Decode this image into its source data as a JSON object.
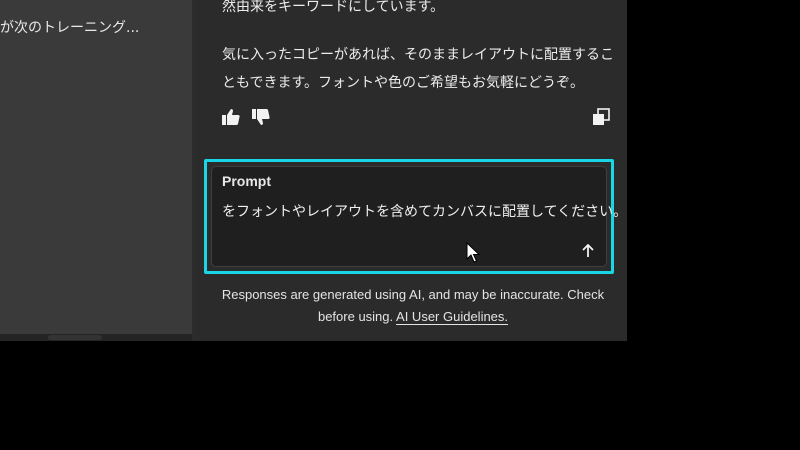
{
  "history": {
    "item_label": "が次のトレーニング..."
  },
  "response": {
    "paragraph1": "然由来をキーワードにしています。",
    "paragraph2": "気に入ったコピーがあれば、そのままレイアウトに配置することもできます。フォントや色のご希望もお気軽にどうぞ。"
  },
  "actions": {
    "thumbs_up_icon": "thumbs-up-icon",
    "thumbs_down_icon": "thumbs-down-icon",
    "copy_icon": "copy-icon"
  },
  "prompt": {
    "label": "Prompt",
    "value": "をフォントやレイアウトを含めてカンバスに配置してください。",
    "highlight_color": "#19d6e4",
    "send_icon": "arrow-up-icon"
  },
  "disclaimer": {
    "text_before": "Responses are generated using AI, and may be inaccurate. Check before using. ",
    "link_label": "AI User Guidelines."
  }
}
